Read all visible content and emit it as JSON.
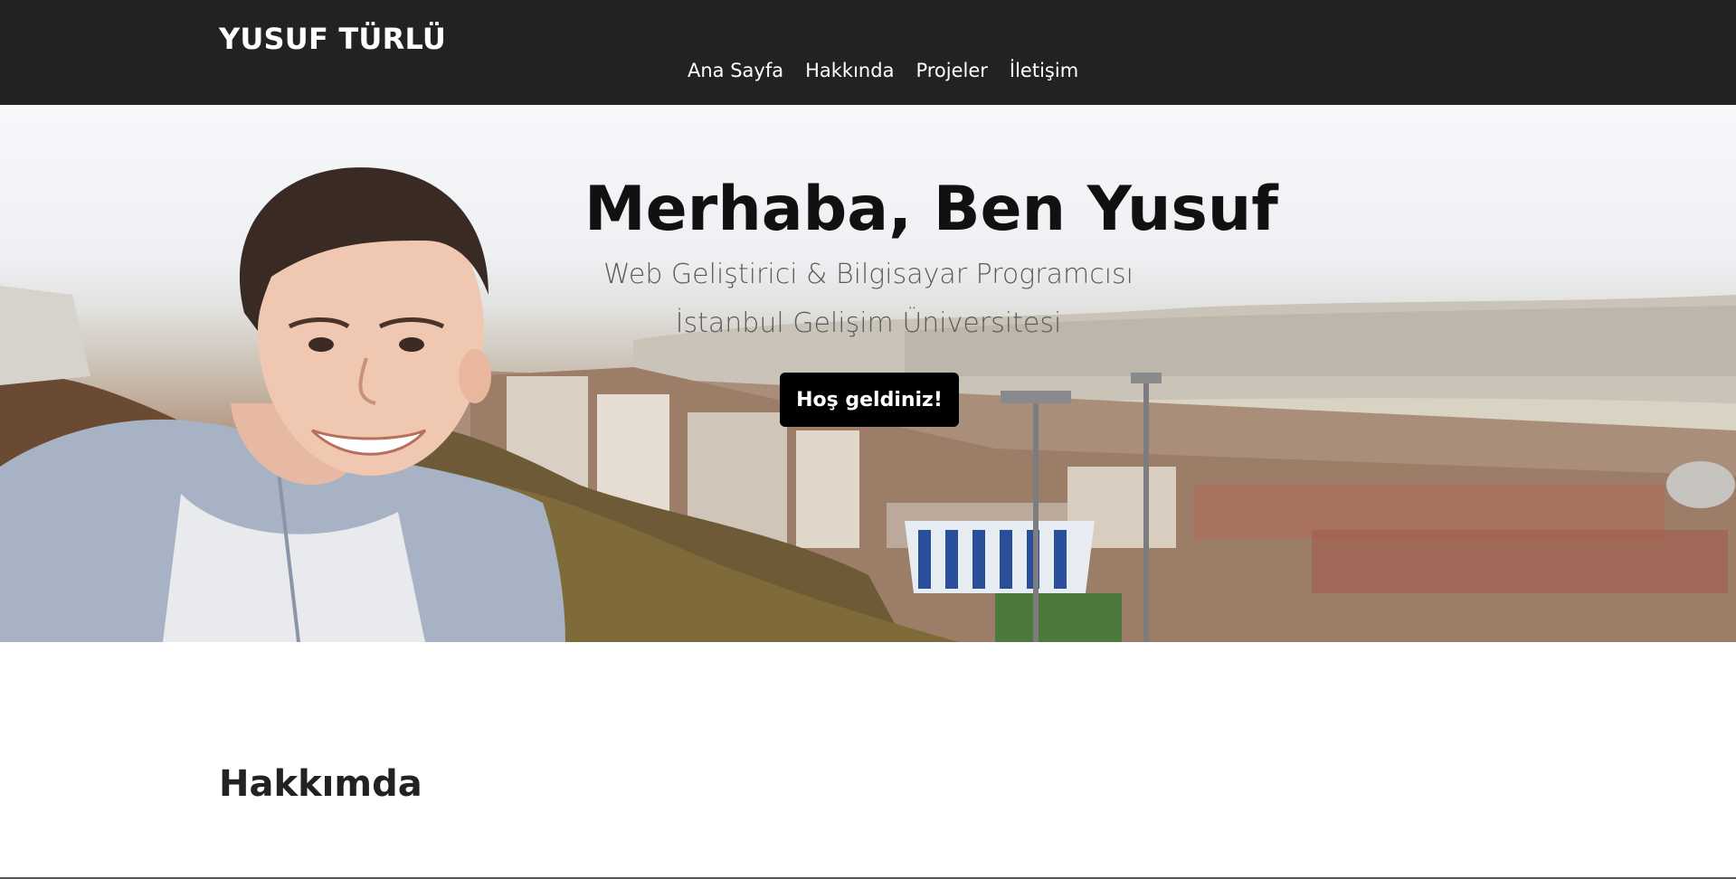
{
  "header": {
    "brand": "YUSUF TÜRLÜ",
    "nav": [
      {
        "label": "Ana Sayfa"
      },
      {
        "label": "Hakkında"
      },
      {
        "label": "Projeler"
      },
      {
        "label": "İletişim"
      }
    ],
    "background_color": "#222222"
  },
  "hero": {
    "title": "Merhaba, Ben Yusuf",
    "subtitle_line1": "Web Geliştirici & Bilgisayar Programcısı",
    "subtitle_line2": "İstanbul Gelişim Üniversitesi",
    "button_label": "Hoş geldiniz!",
    "button_color": "#000000",
    "background_image": "portrait-over-istanbul-cityscape-photo"
  },
  "about": {
    "title": "Hakkımda"
  }
}
